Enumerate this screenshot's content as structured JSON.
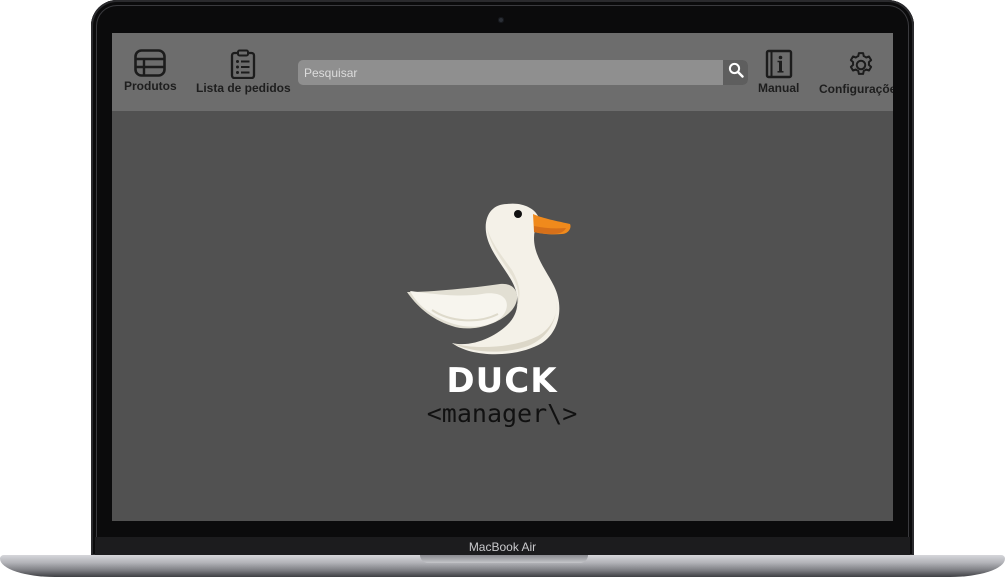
{
  "device": {
    "model_label": "MacBook Air"
  },
  "app": {
    "toolbar": {
      "items": [
        {
          "label": "Produtos",
          "icon": "table-icon"
        },
        {
          "label": "Lista de pedidos",
          "icon": "clipboard-list-icon"
        },
        {
          "label": "Manual",
          "icon": "info-book-icon"
        },
        {
          "label": "Configurações",
          "icon": "gear-icon"
        }
      ],
      "search": {
        "placeholder": "Pesquisar",
        "value": "",
        "icon": "search-icon"
      }
    },
    "brand": {
      "name": "DUCK",
      "tagline": "<manager\\>"
    }
  },
  "colors": {
    "screen_bg": "#515151",
    "toolbar_bg": "#6d6d6d",
    "search_bg": "#8f8f8f",
    "search_btn_bg": "#5e5e5e",
    "duck_body": "#f3f0e6",
    "duck_beak": "#f08a1c"
  }
}
